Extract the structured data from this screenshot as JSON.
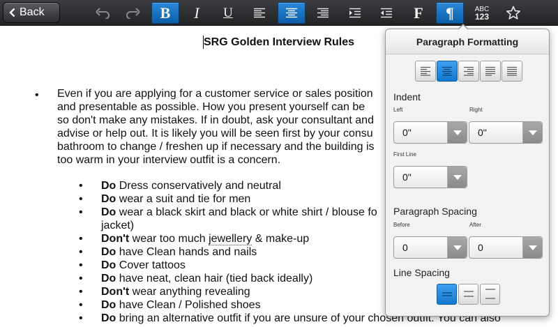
{
  "toolbar": {
    "back_label": "Back",
    "abc_top": "ABC",
    "abc_bottom": "123",
    "bold_glyph": "B",
    "italic_glyph": "I",
    "underline_glyph": "U",
    "font_glyph": "F",
    "paragraph_glyph": "¶",
    "accent_color": "#1a7fd4"
  },
  "document": {
    "title": "SRG Golden Interview Rules",
    "bullet_symbol": "•",
    "paragraph_lines": [
      "Even if you are applying for a customer service or sales position",
      "and presentable as possible.  How you present yourself can be",
      "so don't make any mistakes.  If in doubt, ask your consultant and",
      "advise or help out.  It is likely you will be seen first by your consu",
      "bathroom to change / freshen up if necessary and the building is",
      "too warm in your interview outfit is a concern."
    ],
    "items": [
      {
        "bold": "Do",
        "text": " Dress conservatively and neutral"
      },
      {
        "bold": "Do",
        "text": " wear a suit and tie for men"
      },
      {
        "bold": "Do",
        "text": " wear a black skirt and black or white shirt / blouse fo"
      },
      {
        "bold": "",
        "text": "jacket)"
      },
      {
        "bold": "Don't",
        "text": " wear too much ",
        "dotted": "jewellery",
        "tail": " & make-up"
      },
      {
        "bold": "Do",
        "text": " have Clean hands and nails"
      },
      {
        "bold": "Do",
        "text": " Cover tattoos"
      },
      {
        "bold": "Do",
        "text": " have neat, clean hair (tied back ideally)"
      },
      {
        "bold": "Don't",
        "text": " wear anything revealing"
      },
      {
        "bold": "Do",
        "text": " have Clean / Polished shoes"
      },
      {
        "bold": "Do",
        "text": " bring an alternative outfit if you are unsure of your chosen outfit.  You can also"
      }
    ]
  },
  "popover": {
    "title": "Paragraph Formatting",
    "indent_label": "Indent",
    "left_label": "Left",
    "right_label": "Right",
    "first_line_label": "First Line",
    "indent_left_value": "0\"",
    "indent_right_value": "0\"",
    "first_line_value": "0\"",
    "spacing_label": "Paragraph Spacing",
    "before_label": "Before",
    "after_label": "After",
    "before_value": "0",
    "after_value": "0",
    "line_spacing_label": "Line Spacing",
    "selected_alignment": "center",
    "selected_line_spacing": "single"
  }
}
